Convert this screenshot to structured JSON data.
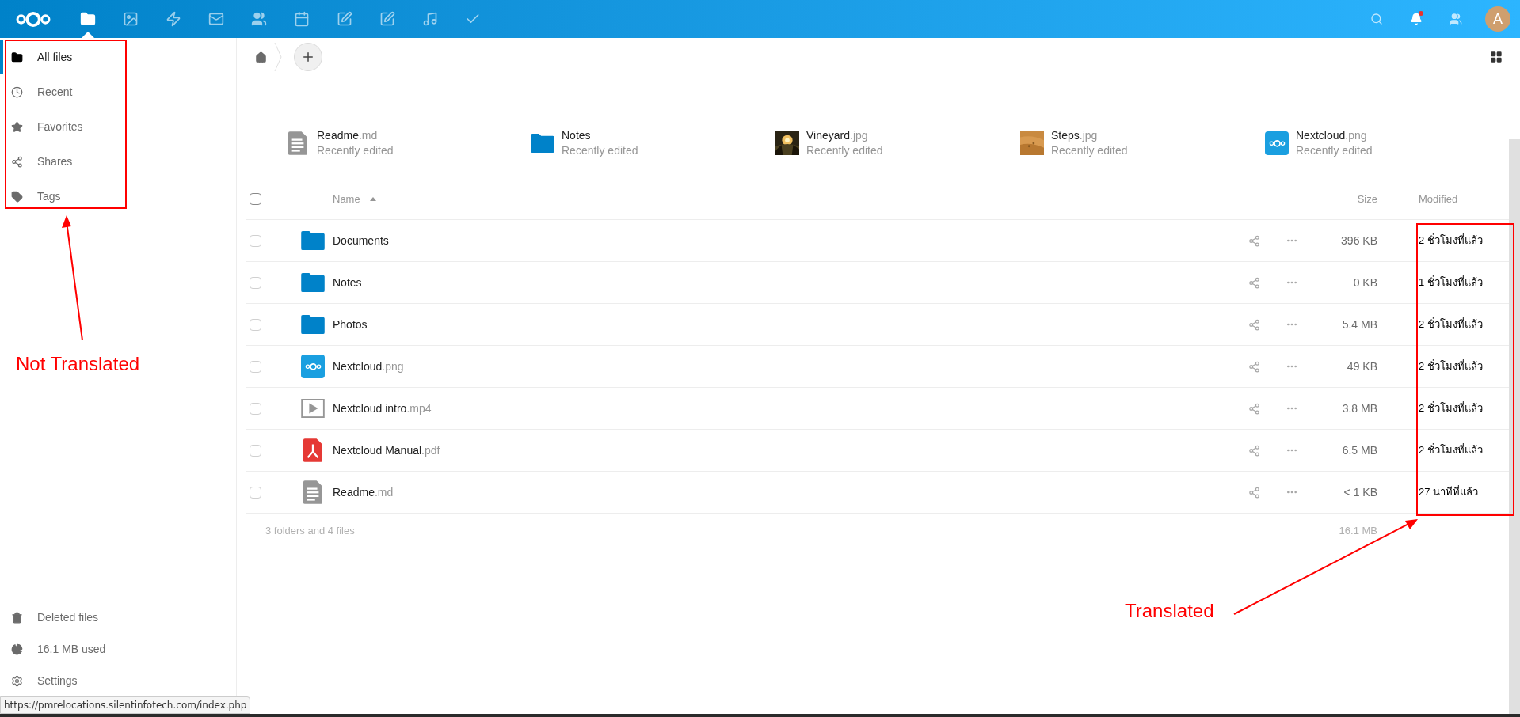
{
  "header": {
    "apps": [
      {
        "kind": "files",
        "selected": true
      },
      {
        "kind": "gallery",
        "selected": false
      },
      {
        "kind": "activity",
        "selected": false
      },
      {
        "kind": "mail",
        "selected": false
      },
      {
        "kind": "contacts",
        "selected": false
      },
      {
        "kind": "calendar",
        "selected": false
      },
      {
        "kind": "notes",
        "selected": false
      },
      {
        "kind": "text",
        "selected": false
      },
      {
        "kind": "music",
        "selected": false
      },
      {
        "kind": "tasks",
        "selected": false
      }
    ],
    "notification_unread": true,
    "avatar": "A"
  },
  "sidebar": {
    "items": [
      {
        "kind": "folder",
        "label": "All files",
        "selected": true
      },
      {
        "kind": "clock",
        "label": "Recent",
        "selected": false
      },
      {
        "kind": "star",
        "label": "Favorites",
        "selected": false
      },
      {
        "kind": "share",
        "label": "Shares",
        "selected": false
      },
      {
        "kind": "tag",
        "label": "Tags",
        "selected": false
      }
    ],
    "bottom_items": [
      {
        "kind": "trash",
        "label": "Deleted files"
      },
      {
        "kind": "quota",
        "label": "16.1 MB used"
      },
      {
        "kind": "settings",
        "label": "Settings"
      }
    ]
  },
  "recent": [
    {
      "kind": "text",
      "name": "Readme",
      "ext": ".md",
      "note": "Recently edited"
    },
    {
      "kind": "folder",
      "name": "Notes",
      "note": "Recently edited"
    },
    {
      "kind": "photo-dark",
      "name": "Vineyard",
      "ext": ".jpg",
      "note": "Recently edited"
    },
    {
      "kind": "photo-sand",
      "name": "Steps",
      "ext": ".jpg",
      "note": "Recently edited"
    },
    {
      "kind": "nextcloud",
      "name": "Nextcloud",
      "ext": ".png",
      "note": "Recently edited"
    }
  ],
  "table": {
    "select_all_checked": false,
    "columns": [
      "Name",
      "Size",
      "Modified"
    ],
    "rows": [
      {
        "kind": "folder",
        "name": "Documents",
        "size": "396 KB",
        "modified": "2 ชั่วโมงที่แล้ว",
        "checked": false
      },
      {
        "kind": "folder",
        "name": "Notes",
        "size": "0 KB",
        "modified": "1 ชั่วโมงที่แล้ว",
        "checked": false
      },
      {
        "kind": "folder",
        "name": "Photos",
        "size": "5.4 MB",
        "modified": "2 ชั่วโมงที่แล้ว",
        "checked": false
      },
      {
        "kind": "nextcloud",
        "name": "Nextcloud",
        "ext": ".png",
        "size": "49 KB",
        "modified": "2 ชั่วโมงที่แล้ว",
        "checked": false
      },
      {
        "kind": "video",
        "name": "Nextcloud intro",
        "ext": ".mp4",
        "size": "3.8 MB",
        "modified": "2 ชั่วโมงที่แล้ว",
        "checked": false
      },
      {
        "kind": "pdf",
        "name": "Nextcloud Manual",
        "ext": ".pdf",
        "size": "6.5 MB",
        "modified": "2 ชั่วโมงที่แล้ว",
        "checked": false
      },
      {
        "kind": "text",
        "name": "Readme",
        "ext": ".md",
        "size": "< 1 KB",
        "modified": "27 นาทีที่แล้ว",
        "checked": false
      }
    ],
    "summary": "3 folders and 4 files",
    "total_size": "16.1 MB"
  },
  "status_url": "https://pmrelocations.silentinfotech.com/index.php",
  "annotations": [
    {
      "text": "Not Translated"
    },
    {
      "text": "Translated"
    }
  ]
}
